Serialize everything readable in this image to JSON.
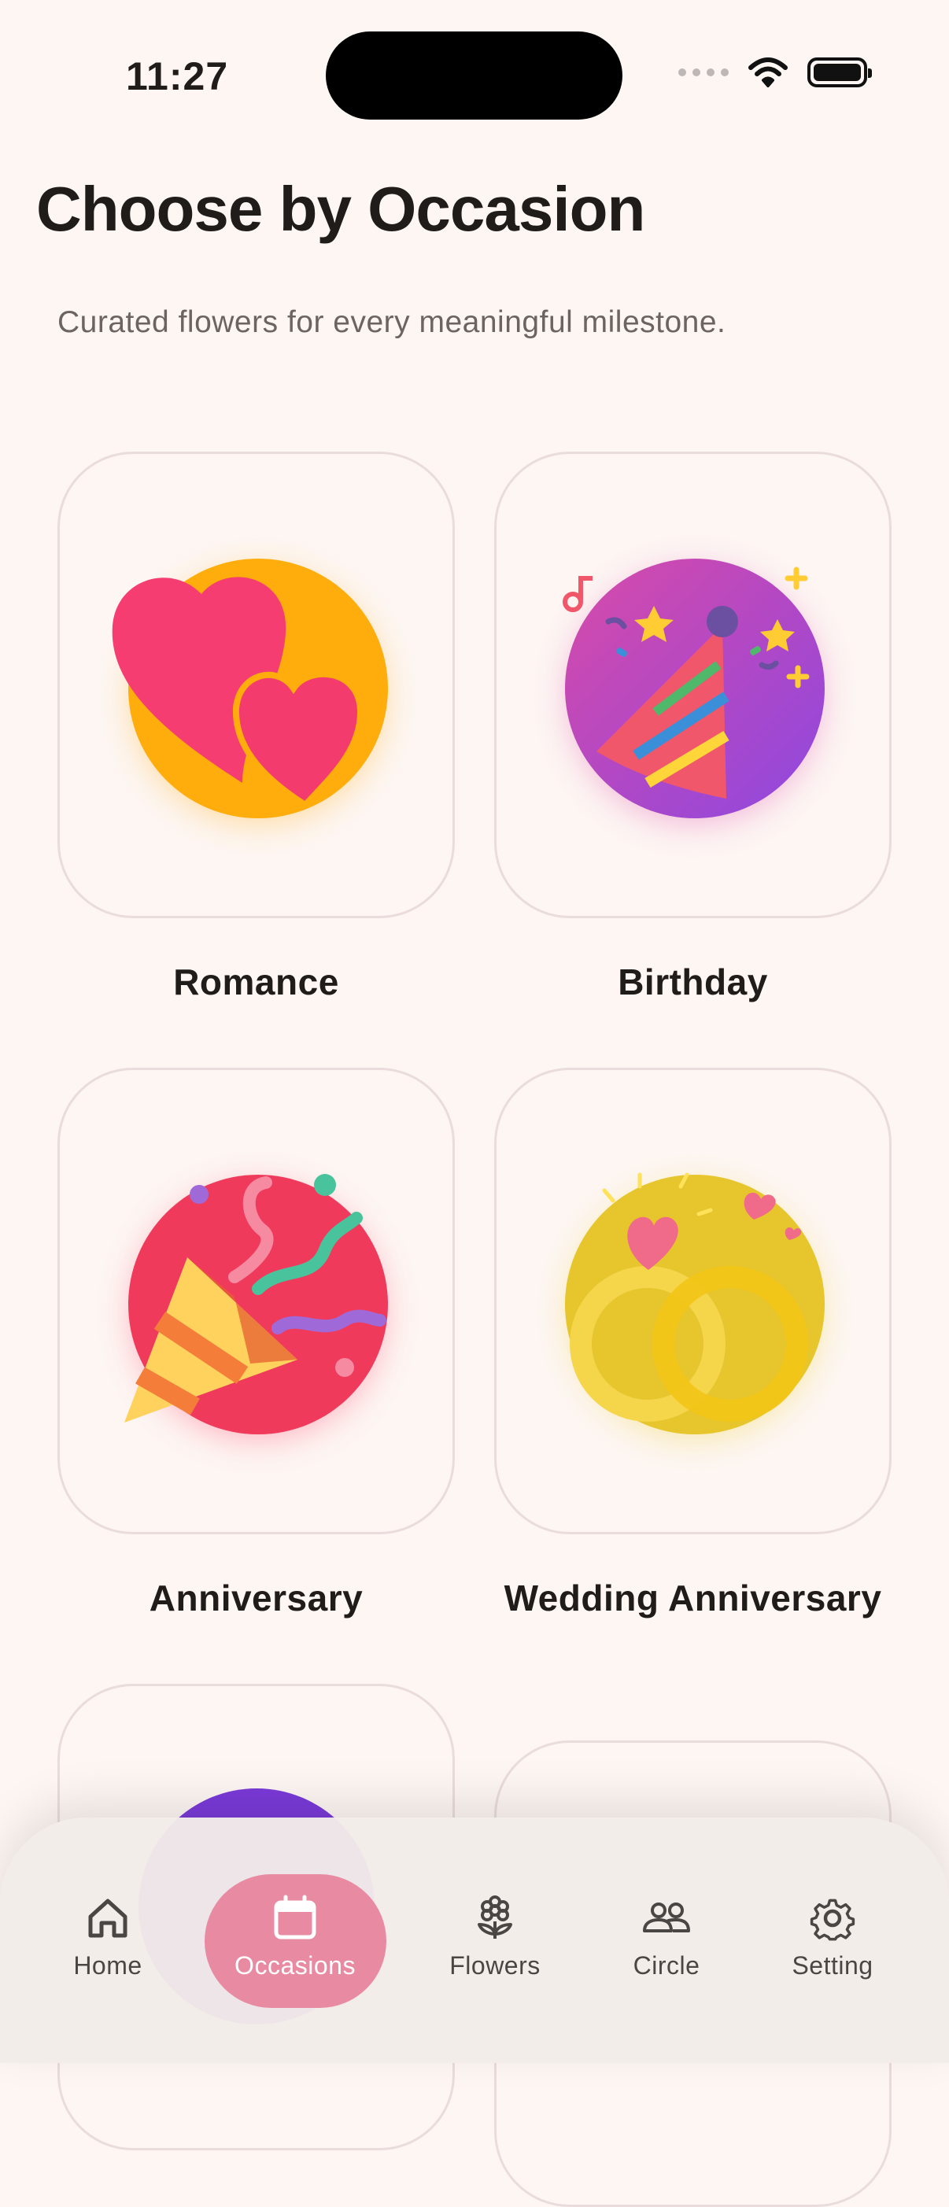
{
  "status_bar": {
    "time": "11:27"
  },
  "header": {
    "title": "Choose by Occasion",
    "subtitle": "Curated flowers for every meaningful milestone."
  },
  "occasions": [
    {
      "label": "Romance",
      "icon": "hearts-icon"
    },
    {
      "label": "Birthday",
      "icon": "party-hat-icon"
    },
    {
      "label": "Anniversary",
      "icon": "party-popper-icon"
    },
    {
      "label": "Wedding Anniversary",
      "icon": "wedding-rings-icon"
    }
  ],
  "nav": {
    "items": [
      {
        "label": "Home",
        "icon": "home-icon"
      },
      {
        "label": "Occasions",
        "icon": "calendar-icon",
        "active": true
      },
      {
        "label": "Flowers",
        "icon": "flower-icon"
      },
      {
        "label": "Circle",
        "icon": "people-icon"
      },
      {
        "label": "Setting",
        "icon": "gear-icon"
      }
    ]
  },
  "colors": {
    "background": "#fdf6f3",
    "accent": "#e88aa2",
    "romance_bg": "#ffad0d",
    "birthday_bg": "#b447c8",
    "anniversary_bg": "#f03a5c",
    "wedding_bg": "#e6c62c"
  }
}
